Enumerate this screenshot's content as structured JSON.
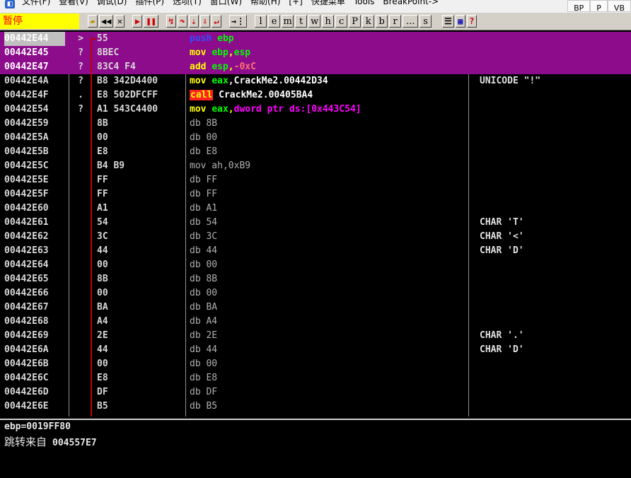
{
  "menu": {
    "items": [
      "文件(F)",
      "查看(V)",
      "调试(D)",
      "插件(P)",
      "选项(T)",
      "窗口(W)",
      "帮助(H)",
      "[+]",
      "快捷菜单",
      "Tools",
      "BreakPoint->"
    ],
    "buttons": [
      "BP",
      "P",
      "VB"
    ]
  },
  "toolbar": {
    "status": "暂停",
    "letters": [
      "l",
      "e",
      "m",
      "t",
      "w",
      "h",
      "c",
      "P",
      "k",
      "b",
      "r",
      "...",
      "s"
    ]
  },
  "disasm": {
    "rows": [
      {
        "addr": "00442E44",
        "mark": ">",
        "hex": "55",
        "inst": [
          [
            "push ",
            "t-push"
          ],
          [
            "ebp",
            "t-reg"
          ]
        ],
        "comment": ""
      },
      {
        "addr": "00442E45",
        "mark": "?",
        "hex": "8BEC",
        "inst": [
          [
            "mov ",
            "t-ins"
          ],
          [
            "ebp",
            "t-reg"
          ],
          [
            ",",
            "t-ins"
          ],
          [
            "esp",
            "t-reg"
          ]
        ],
        "comment": ""
      },
      {
        "addr": "00442E47",
        "mark": "?",
        "hex": "83C4 F4",
        "inst": [
          [
            "add ",
            "t-ins"
          ],
          [
            "esp",
            "t-reg"
          ],
          [
            ",",
            "t-ins"
          ],
          [
            "-0xC",
            "t-num2"
          ]
        ],
        "comment": ""
      },
      {
        "addr": "00442E4A",
        "mark": "?",
        "hex": "B8 342D4400",
        "inst": [
          [
            "mov ",
            "t-ins"
          ],
          [
            "eax",
            "t-reg"
          ],
          [
            ",CrackMe2.00442D34",
            "t-white"
          ]
        ],
        "comment": "UNICODE \"!\""
      },
      {
        "addr": "00442E4F",
        "mark": ".",
        "hex": "E8 502DFCFF",
        "inst": [
          [
            "call",
            "t-call"
          ],
          [
            " CrackMe2.00405BA4",
            "t-white"
          ]
        ],
        "comment": ""
      },
      {
        "addr": "00442E54",
        "mark": "?",
        "hex": "A1 543C4400",
        "inst": [
          [
            "mov ",
            "t-ins"
          ],
          [
            "eax",
            "t-reg"
          ],
          [
            ",",
            "t-ins"
          ],
          [
            "dword ptr ds:[0x443C54]",
            "t-mem"
          ]
        ],
        "comment": ""
      },
      {
        "addr": "00442E59",
        "mark": "",
        "hex": "8B",
        "inst": [
          [
            "db 8B",
            "t-db"
          ]
        ],
        "comment": ""
      },
      {
        "addr": "00442E5A",
        "mark": "",
        "hex": "00",
        "inst": [
          [
            "db 00",
            "t-db"
          ]
        ],
        "comment": ""
      },
      {
        "addr": "00442E5B",
        "mark": "",
        "hex": "E8",
        "inst": [
          [
            "db E8",
            "t-db"
          ]
        ],
        "comment": ""
      },
      {
        "addr": "00442E5C",
        "mark": "",
        "hex": "B4 B9",
        "inst": [
          [
            "mov ah,0xB9",
            "t-db"
          ]
        ],
        "comment": ""
      },
      {
        "addr": "00442E5E",
        "mark": "",
        "hex": "FF",
        "inst": [
          [
            "db FF",
            "t-db"
          ]
        ],
        "comment": ""
      },
      {
        "addr": "00442E5F",
        "mark": "",
        "hex": "FF",
        "inst": [
          [
            "db FF",
            "t-db"
          ]
        ],
        "comment": ""
      },
      {
        "addr": "00442E60",
        "mark": "",
        "hex": "A1",
        "inst": [
          [
            "db A1",
            "t-db"
          ]
        ],
        "comment": ""
      },
      {
        "addr": "00442E61",
        "mark": "",
        "hex": "54",
        "inst": [
          [
            "db 54",
            "t-db"
          ]
        ],
        "comment": "CHAR 'T'"
      },
      {
        "addr": "00442E62",
        "mark": "",
        "hex": "3C",
        "inst": [
          [
            "db 3C",
            "t-db"
          ]
        ],
        "comment": "CHAR '<'"
      },
      {
        "addr": "00442E63",
        "mark": "",
        "hex": "44",
        "inst": [
          [
            "db 44",
            "t-db"
          ]
        ],
        "comment": "CHAR 'D'"
      },
      {
        "addr": "00442E64",
        "mark": "",
        "hex": "00",
        "inst": [
          [
            "db 00",
            "t-db"
          ]
        ],
        "comment": ""
      },
      {
        "addr": "00442E65",
        "mark": "",
        "hex": "8B",
        "inst": [
          [
            "db 8B",
            "t-db"
          ]
        ],
        "comment": ""
      },
      {
        "addr": "00442E66",
        "mark": "",
        "hex": "00",
        "inst": [
          [
            "db 00",
            "t-db"
          ]
        ],
        "comment": ""
      },
      {
        "addr": "00442E67",
        "mark": "",
        "hex": "BA",
        "inst": [
          [
            "db BA",
            "t-db"
          ]
        ],
        "comment": ""
      },
      {
        "addr": "00442E68",
        "mark": "",
        "hex": "A4",
        "inst": [
          [
            "db A4",
            "t-db"
          ]
        ],
        "comment": ""
      },
      {
        "addr": "00442E69",
        "mark": "",
        "hex": "2E",
        "inst": [
          [
            "db 2E",
            "t-db"
          ]
        ],
        "comment": "CHAR '.'"
      },
      {
        "addr": "00442E6A",
        "mark": "",
        "hex": "44",
        "inst": [
          [
            "db 44",
            "t-db"
          ]
        ],
        "comment": "CHAR 'D'"
      },
      {
        "addr": "00442E6B",
        "mark": "",
        "hex": "00",
        "inst": [
          [
            "db 00",
            "t-db"
          ]
        ],
        "comment": ""
      },
      {
        "addr": "00442E6C",
        "mark": "",
        "hex": "E8",
        "inst": [
          [
            "db E8",
            "t-db"
          ]
        ],
        "comment": ""
      },
      {
        "addr": "00442E6D",
        "mark": "",
        "hex": "DF",
        "inst": [
          [
            "db DF",
            "t-db"
          ]
        ],
        "comment": ""
      },
      {
        "addr": "00442E6E",
        "mark": "",
        "hex": "B5",
        "inst": [
          [
            "db B5",
            "t-db"
          ]
        ],
        "comment": ""
      }
    ]
  },
  "info": {
    "line1": "ebp=0019FF80",
    "line2_label": "跳转来自",
    "line2_addr": "004557E7"
  }
}
